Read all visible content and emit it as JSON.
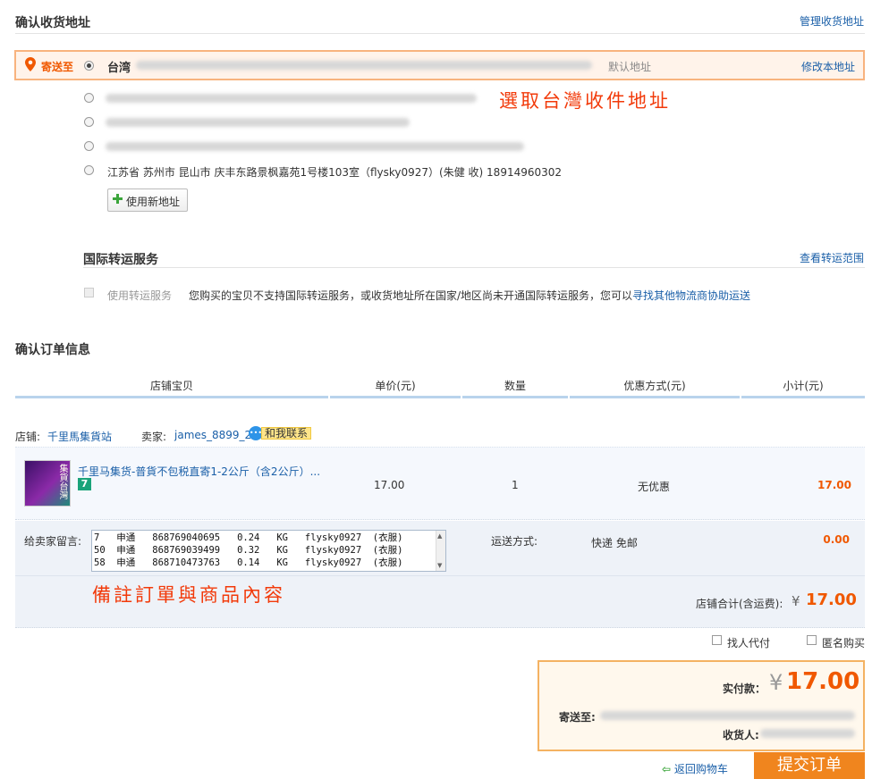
{
  "address": {
    "title": "确认收货地址",
    "manage_link": "管理收货地址",
    "ship_to_label": "寄送至",
    "selected_region": "台湾",
    "default_tag": "默认地址",
    "edit_link": "修改本地址",
    "visible_address": "江苏省 苏州市 昆山市 庆丰东路景枫嘉苑1号楼103室（flysky0927）(朱健 收) 18914960302",
    "new_address_button": "使用新地址",
    "annotation": "選取台灣收件地址"
  },
  "transship": {
    "title": "国际转运服务",
    "range_link": "查看转运范围",
    "checkbox_label": "使用转运服务",
    "notice": "您购买的宝贝不支持国际转运服务，或收货地址所在国家/地区尚未开通国际转运服务，您可以",
    "notice_link": "寻找其他物流商协助运送"
  },
  "order": {
    "title": "确认订单信息",
    "columns": [
      "店铺宝贝",
      "单价(元)",
      "数量",
      "优惠方式(元)",
      "小计(元)"
    ],
    "shop_label": "店铺:",
    "shop_name": "千里馬集貨站",
    "seller_label": "卖家:",
    "seller_name": "james_8899_2",
    "contact_label": "和我联系",
    "item": {
      "name": "千里马集货-普貨不包税直寄1-2公斤（含2公斤）...",
      "thumb_text": "集貨台灣",
      "badge": "7",
      "price": "17.00",
      "qty": "1",
      "discount": "无优惠",
      "subtotal": "17.00"
    },
    "message_label": "给卖家留言:",
    "message_text": "7   申通   868769040695   0.24   KG   flysky0927  (衣服)\n50  申通   868769039499   0.32   KG   flysky0927  (衣服)\n58  申通   868710473763   0.14   KG   flysky0927  (衣服)",
    "shipping_label": "运送方式:",
    "shipping_method": "快递 免邮",
    "shipping_fee": "0.00",
    "shop_total_label": "店铺合计(含运费):",
    "currency": "¥",
    "shop_total": "17.00",
    "annotation": "備註訂單與商品內容"
  },
  "options": {
    "proxy_pay": "找人代付",
    "anonymous": "匿名购买"
  },
  "summary": {
    "pay_label": "实付款：",
    "currency": "¥",
    "amount": "17.00",
    "ship_to_label": "寄送至:",
    "receiver_label": "收货人:"
  },
  "footer": {
    "back_link": "返回购物车",
    "submit_button": "提交订单"
  },
  "colors": {
    "accent": "#f05800",
    "link": "#1a5fa8",
    "submit_bg": "#f0851e",
    "annotation": "#f23a0a"
  }
}
